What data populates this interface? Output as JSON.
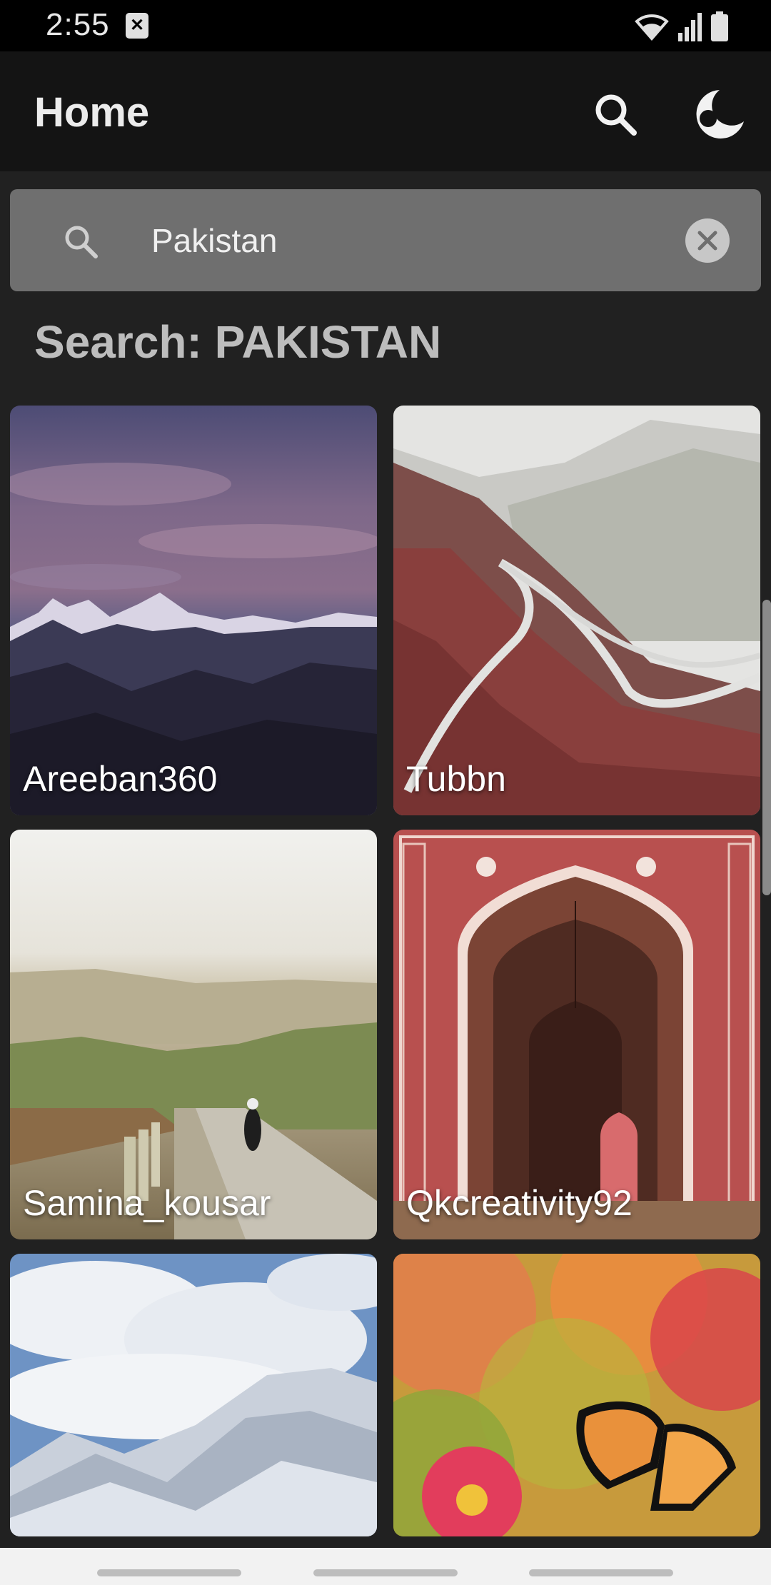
{
  "status_bar": {
    "time": "2:55",
    "notification_icon": "x-notification-icon",
    "icons": [
      "wifi-icon",
      "signal-icon",
      "battery-icon"
    ]
  },
  "app_bar": {
    "title": "Home",
    "actions": [
      "search-icon",
      "moon-theme-icon"
    ]
  },
  "search": {
    "value": "Pakistan",
    "icon": "search-icon",
    "clear_icon": "clear-icon"
  },
  "results": {
    "heading": "Search: PAKISTAN",
    "items": [
      {
        "label": "Areeban360"
      },
      {
        "label": "Tubbn"
      },
      {
        "label": "Samina_kousar"
      },
      {
        "label": "Qkcreativity92"
      },
      {
        "label": ""
      },
      {
        "label": ""
      }
    ]
  },
  "colors": {
    "background": "#212121",
    "app_bar": "#141414",
    "search_field": "#6f6f6f",
    "heading_text": "#bdbdbd"
  }
}
